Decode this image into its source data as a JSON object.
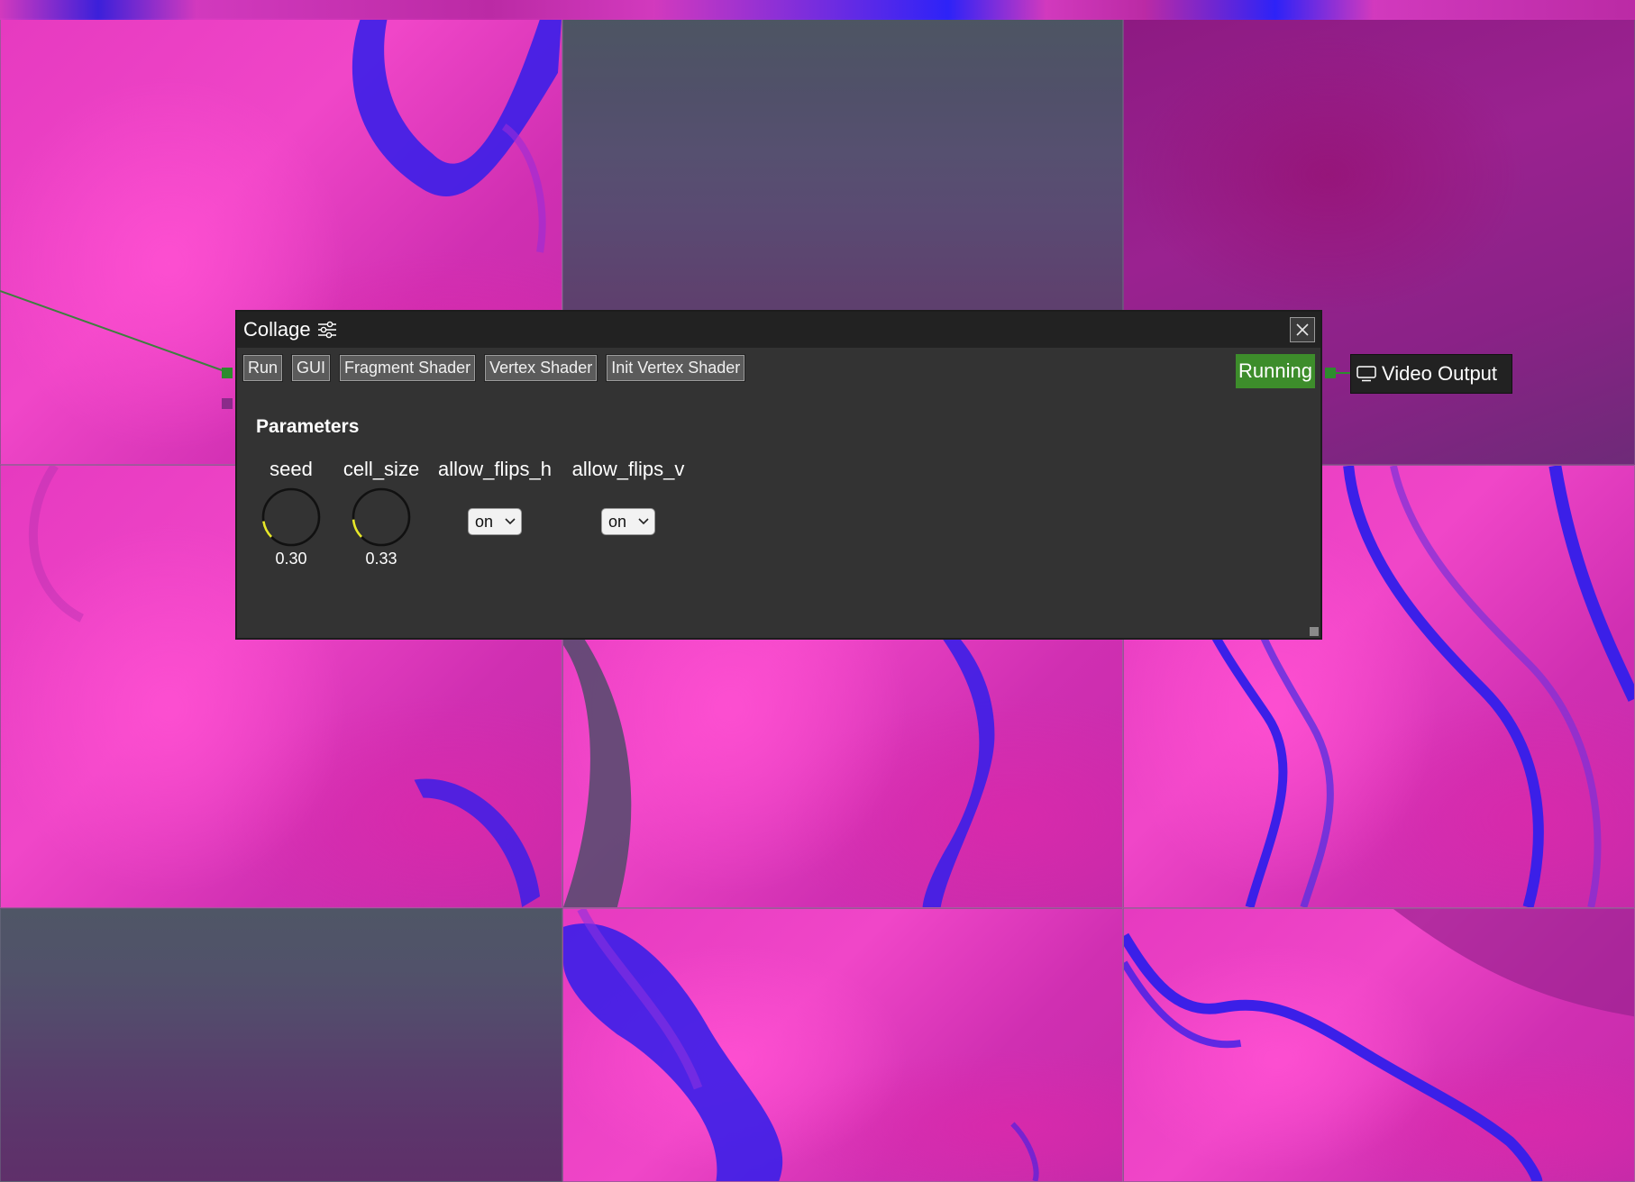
{
  "node": {
    "title": "Collage",
    "title_icon": "sliders-icon",
    "close_icon": "close-icon",
    "toolbar": {
      "run_label": "Run",
      "gui_label": "GUI",
      "fragment_label": "Fragment Shader",
      "vertex_label": "Vertex Shader",
      "init_vertex_label": "Init Vertex Shader"
    },
    "status": "Running",
    "params_heading": "Parameters",
    "params": {
      "seed": {
        "label": "seed",
        "value": "0.30",
        "level": 0.3
      },
      "cell_size": {
        "label": "cell_size",
        "value": "0.33",
        "level": 0.33
      },
      "allow_flips_h": {
        "label": "allow_flips_h",
        "selected": "on"
      },
      "allow_flips_v": {
        "label": "allow_flips_v",
        "selected": "on"
      }
    }
  },
  "video_output": {
    "label": "Video Output",
    "icon": "monitor-icon"
  },
  "colors": {
    "status_green": "#3d8d2b",
    "knob_arc": "#e8e82a",
    "port_green": "#2e8b2e",
    "port_purple": "#8a2b8a",
    "node_bg": "#333333",
    "titlebar_bg": "#222222"
  }
}
